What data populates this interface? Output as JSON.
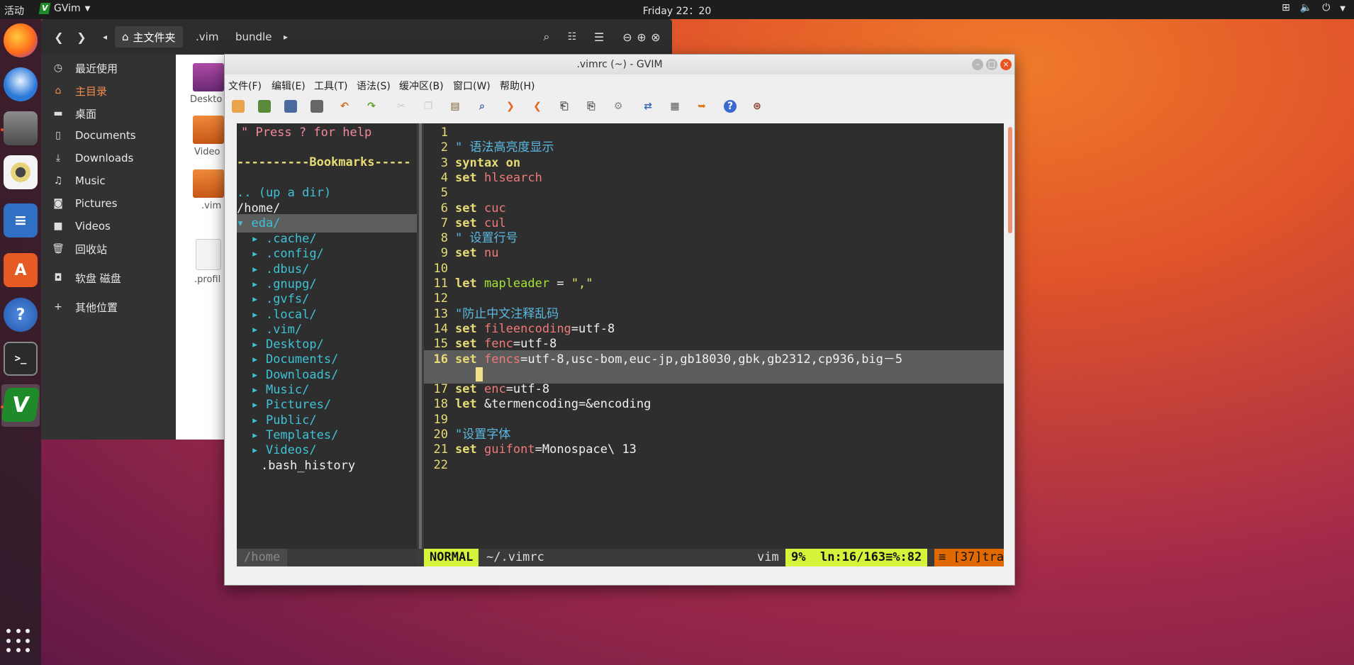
{
  "topbar": {
    "activities": "活动",
    "app_name": "GVim",
    "clock": "Friday 22：20"
  },
  "dock": {
    "icons": [
      "firefox-icon",
      "thunderbird-icon",
      "files-icon",
      "rhythmbox-icon",
      "libreoffice-writer-icon",
      "software-center-icon",
      "help-icon",
      "terminal-icon",
      "gvim-icon",
      "show-apps-icon"
    ],
    "terminal_glyph": ">_",
    "help_glyph": "?",
    "vim_glyph": "V"
  },
  "files": {
    "breadcrumbs": [
      "主文件夹",
      ".vim",
      "bundle"
    ],
    "sidebar": [
      {
        "label": "最近使用",
        "icon": "clock-icon"
      },
      {
        "label": "主目录",
        "icon": "home-icon"
      },
      {
        "label": "桌面",
        "icon": "folder-icon"
      },
      {
        "label": "Documents",
        "icon": "document-icon"
      },
      {
        "label": "Downloads",
        "icon": "download-icon"
      },
      {
        "label": "Music",
        "icon": "music-icon"
      },
      {
        "label": "Pictures",
        "icon": "camera-icon"
      },
      {
        "label": "Videos",
        "icon": "video-icon"
      },
      {
        "label": "回收站",
        "icon": "trash-icon"
      },
      {
        "label": "软盘 磁盘",
        "icon": "disk-icon"
      },
      {
        "label": "其他位置",
        "icon": "plus-icon"
      }
    ],
    "items": [
      "Deskto",
      "Video",
      ".vim",
      ".profil"
    ]
  },
  "gvim": {
    "title": ".vimrc (~) - GVIM",
    "menu": [
      "文件(F)",
      "编辑(E)",
      "工具(T)",
      "语法(S)",
      "缓冲区(B)",
      "窗口(W)",
      "帮助(H)"
    ],
    "toolbar_icons": [
      "open-icon",
      "save-icon",
      "save-all-icon",
      "print-icon",
      "undo-icon",
      "redo-icon",
      "cut-icon",
      "copy-icon",
      "paste-icon",
      "find-replace-icon",
      "find-next-icon",
      "find-prev-icon",
      "load-session-icon",
      "save-session-icon",
      "run-script-icon",
      "make-icon",
      "shell-icon",
      "ctags-icon",
      "help-icon",
      "find-help-icon"
    ],
    "tree": {
      "help": "\" Press ? for help",
      "bookmarks": "----------Bookmarks-----",
      "up": ".. (up a dir)",
      "root": "/home/",
      "open_dir": "▾ eda/",
      "children": [
        ".cache/",
        ".config/",
        ".dbus/",
        ".gnupg/",
        ".gvfs/",
        ".local/",
        ".vim/",
        "Desktop/",
        "Documents/",
        "Downloads/",
        "Music/",
        "Pictures/",
        "Public/",
        "Templates/",
        "Videos/"
      ],
      "last_file": ".bash_history",
      "status": "/home"
    },
    "code": [
      {
        "n": "1",
        "parts": []
      },
      {
        "n": "2",
        "parts": [
          [
            "cm",
            "\" 语法高亮度显示"
          ]
        ]
      },
      {
        "n": "3",
        "parts": [
          [
            "kw",
            "syntax"
          ],
          [
            "",
            " "
          ],
          [
            "kw",
            "on"
          ]
        ]
      },
      {
        "n": "4",
        "parts": [
          [
            "kw",
            "set"
          ],
          [
            "",
            " "
          ],
          [
            "opt",
            "hlsearch"
          ]
        ]
      },
      {
        "n": "5",
        "parts": []
      },
      {
        "n": "6",
        "parts": [
          [
            "kw",
            "set"
          ],
          [
            "",
            " "
          ],
          [
            "opt",
            "cuc"
          ]
        ]
      },
      {
        "n": "7",
        "parts": [
          [
            "kw",
            "set"
          ],
          [
            "",
            " "
          ],
          [
            "opt",
            "cul"
          ]
        ]
      },
      {
        "n": "8",
        "parts": [
          [
            "cm",
            "\" 设置行号"
          ]
        ]
      },
      {
        "n": "9",
        "parts": [
          [
            "kw",
            "set"
          ],
          [
            "",
            " "
          ],
          [
            "opt",
            "nu"
          ]
        ]
      },
      {
        "n": "10",
        "parts": []
      },
      {
        "n": "11",
        "parts": [
          [
            "kw",
            "let"
          ],
          [
            "",
            " "
          ],
          [
            "grn",
            "mapleader"
          ],
          [
            "",
            " = "
          ],
          [
            "str",
            "\",\""
          ]
        ]
      },
      {
        "n": "12",
        "parts": []
      },
      {
        "n": "13",
        "parts": [
          [
            "cm",
            "\"防止中文注释乱码"
          ]
        ]
      },
      {
        "n": "14",
        "parts": [
          [
            "kw",
            "set"
          ],
          [
            "",
            " "
          ],
          [
            "opt",
            "fileencoding"
          ],
          [
            "",
            "=utf-8"
          ]
        ]
      },
      {
        "n": "15",
        "parts": [
          [
            "kw",
            "set"
          ],
          [
            "",
            " "
          ],
          [
            "opt",
            "fenc"
          ],
          [
            "",
            "=utf-8"
          ]
        ]
      },
      {
        "n": "16",
        "parts": [
          [
            "kw",
            "set"
          ],
          [
            "",
            " "
          ],
          [
            "opt",
            "fencs"
          ],
          [
            "",
            "=utf-8,usc-bom,euc-jp,gb18030,gbk,gb2312,cp936,big－5"
          ]
        ],
        "current": true
      },
      {
        "n": "",
        "parts": [],
        "current": true,
        "cursor": true
      },
      {
        "n": "17",
        "parts": [
          [
            "kw",
            "set"
          ],
          [
            "",
            " "
          ],
          [
            "opt",
            "enc"
          ],
          [
            "",
            "=utf-8"
          ]
        ]
      },
      {
        "n": "18",
        "parts": [
          [
            "kw",
            "let"
          ],
          [
            "",
            " &termencoding=&encoding"
          ]
        ]
      },
      {
        "n": "19",
        "parts": []
      },
      {
        "n": "20",
        "parts": [
          [
            "cm",
            "\"设置字体"
          ]
        ]
      },
      {
        "n": "21",
        "parts": [
          [
            "kw",
            "set"
          ],
          [
            "",
            " "
          ],
          [
            "opt",
            "guifont"
          ],
          [
            "",
            "=Monospace\\ 13"
          ]
        ]
      },
      {
        "n": "22",
        "parts": []
      }
    ],
    "status": {
      "mode": "NORMAL",
      "file": "~/.vimrc",
      "filetype": "vim",
      "percent": "9%",
      "position": "ln:16/163≡%:82",
      "warning": "≡ [37]tra…"
    }
  }
}
